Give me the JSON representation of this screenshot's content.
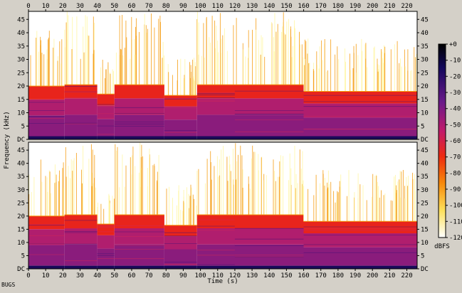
{
  "footer": {
    "label": "BUGS"
  },
  "chart_data": {
    "type": "heatmap",
    "xlabel": "Time (s)",
    "ylabel": "Frequency (kHz)",
    "x_ticks": [
      0,
      10,
      20,
      30,
      40,
      50,
      60,
      70,
      80,
      90,
      100,
      110,
      120,
      130,
      140,
      150,
      160,
      170,
      180,
      190,
      200,
      210,
      220
    ],
    "xlim": [
      0,
      226
    ],
    "y_ticks": [
      "DC",
      "5",
      "10",
      "15",
      "20",
      "25",
      "30",
      "35",
      "40",
      "45"
    ],
    "y_tick_values": [
      0,
      5,
      10,
      15,
      20,
      25,
      30,
      35,
      40,
      45
    ],
    "ylim": [
      0,
      48
    ],
    "colorbar": {
      "unit": "dBFS",
      "ticks": [
        "+0",
        "-10",
        "-20",
        "-30",
        "-40",
        "-50",
        "-60",
        "-70",
        "-80",
        "-90",
        "-100",
        "-110",
        "-120"
      ],
      "range": [
        -120,
        0
      ]
    },
    "channels": [
      {
        "segments": [
          {
            "start": 0,
            "end": 21,
            "cutoff_khz": 20,
            "top_khz": 42
          },
          {
            "start": 21,
            "end": 40,
            "cutoff_khz": 20.5,
            "top_khz": 48
          },
          {
            "start": 40,
            "end": 50,
            "cutoff_khz": 17,
            "top_khz": 30
          },
          {
            "start": 50,
            "end": 79,
            "cutoff_khz": 20.5,
            "top_khz": 48
          },
          {
            "start": 79,
            "end": 98,
            "cutoff_khz": 16.5,
            "top_khz": 32
          },
          {
            "start": 98,
            "end": 120,
            "cutoff_khz": 20.5,
            "top_khz": 48
          },
          {
            "start": 120,
            "end": 160,
            "cutoff_khz": 20.5,
            "top_khz": 48
          },
          {
            "start": 160,
            "end": 226,
            "cutoff_khz": 18,
            "top_khz": 38
          }
        ]
      },
      {
        "segments": [
          {
            "start": 0,
            "end": 21,
            "cutoff_khz": 20,
            "top_khz": 42
          },
          {
            "start": 21,
            "end": 40,
            "cutoff_khz": 20.5,
            "top_khz": 48
          },
          {
            "start": 40,
            "end": 50,
            "cutoff_khz": 17,
            "top_khz": 30
          },
          {
            "start": 50,
            "end": 79,
            "cutoff_khz": 20.5,
            "top_khz": 48
          },
          {
            "start": 79,
            "end": 98,
            "cutoff_khz": 16.5,
            "top_khz": 32
          },
          {
            "start": 98,
            "end": 120,
            "cutoff_khz": 20.5,
            "top_khz": 48
          },
          {
            "start": 120,
            "end": 160,
            "cutoff_khz": 20.5,
            "top_khz": 48
          },
          {
            "start": 160,
            "end": 226,
            "cutoff_khz": 18,
            "top_khz": 38
          }
        ]
      }
    ],
    "colors": {
      "loud": "#1a0a5a",
      "mid": "#8a1c7c",
      "hot": "#e8241c",
      "warm": "#f59a0c",
      "faint": "#fff6a0",
      "silent": "#ffffff"
    }
  }
}
